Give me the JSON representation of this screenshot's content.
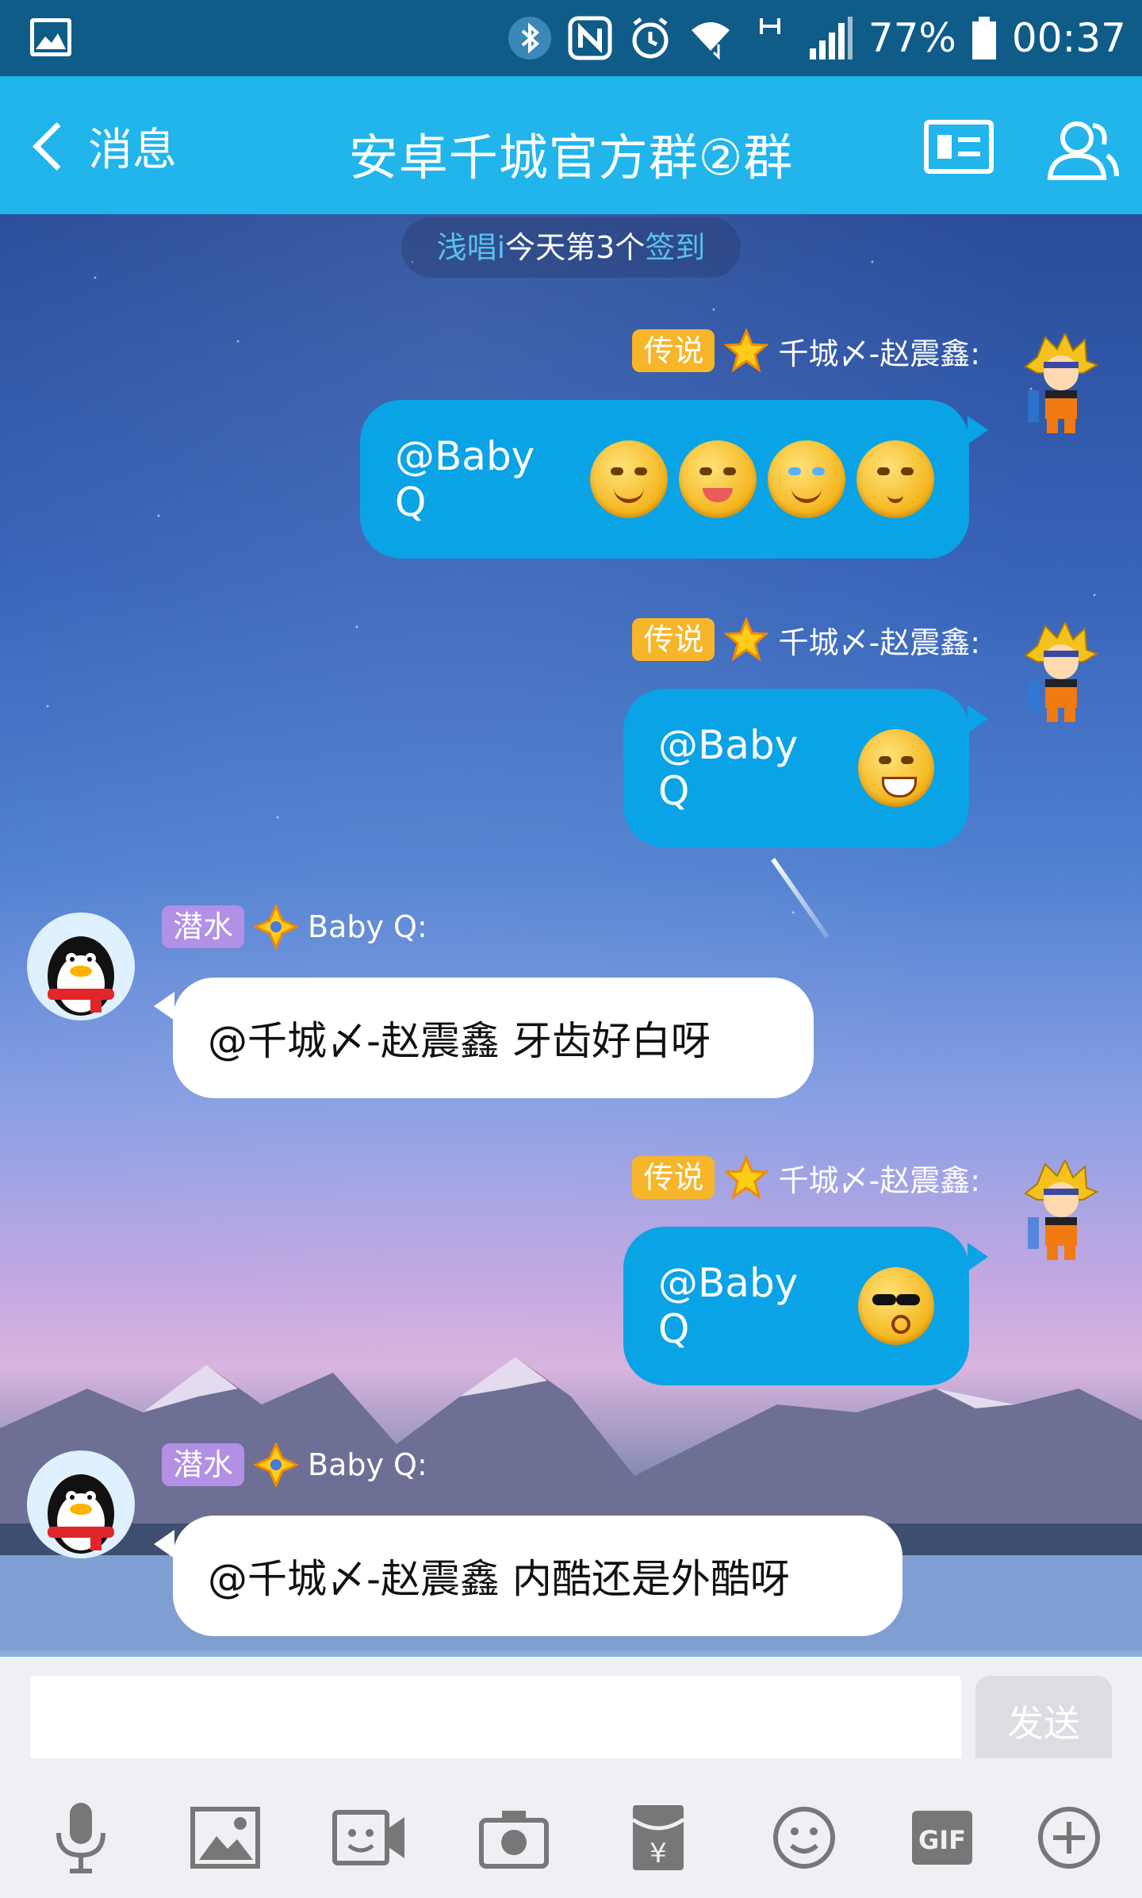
{
  "status_bar": {
    "battery": "77%",
    "time": "00:37",
    "icons": [
      "image-icon",
      "bluetooth-icon",
      "nfc-icon",
      "alarm-icon",
      "wifi-icon",
      "signal-h-icon",
      "signal-icon",
      "battery-icon"
    ]
  },
  "header": {
    "back_label": "消息",
    "title": "安卓千城官方群②群"
  },
  "notice": {
    "name": "浅唱i",
    "middle": "今天第3个",
    "action": "签到"
  },
  "messages": [
    {
      "direction": "out",
      "badge": "传说",
      "sender": "千城〆-赵震鑫:",
      "text": "@Baby Q",
      "emoji_count": 4
    },
    {
      "direction": "out",
      "badge": "传说",
      "sender": "千城〆-赵震鑫:",
      "text": "@Baby Q",
      "emoji_count": 1
    },
    {
      "direction": "in",
      "badge": "潜水",
      "sender": "Baby Q:",
      "text": "@千城〆-赵震鑫 牙齿好白呀",
      "emoji_count": 0
    },
    {
      "direction": "out",
      "badge": "传说",
      "sender": "千城〆-赵震鑫:",
      "text": "@Baby Q",
      "emoji_count": 1
    },
    {
      "direction": "in",
      "badge": "潜水",
      "sender": "Baby Q:",
      "text": "@千城〆-赵震鑫 内酷还是外酷呀",
      "emoji_count": 0
    }
  ],
  "input": {
    "value": "",
    "send_label": "发送"
  },
  "toolbar": {
    "icons": [
      "microphone-icon",
      "image-icon",
      "video-call-icon",
      "camera-icon",
      "red-packet-icon",
      "emoji-icon",
      "gif-icon",
      "plus-icon"
    ],
    "gif_label": "GIF"
  },
  "colors": {
    "status_bar": "#0f5c88",
    "title_bar": "#21b5ec",
    "out_bubble": "#0aa3e5",
    "badge_legend": "#f7b52a",
    "badge_dive": "#b190e6"
  }
}
